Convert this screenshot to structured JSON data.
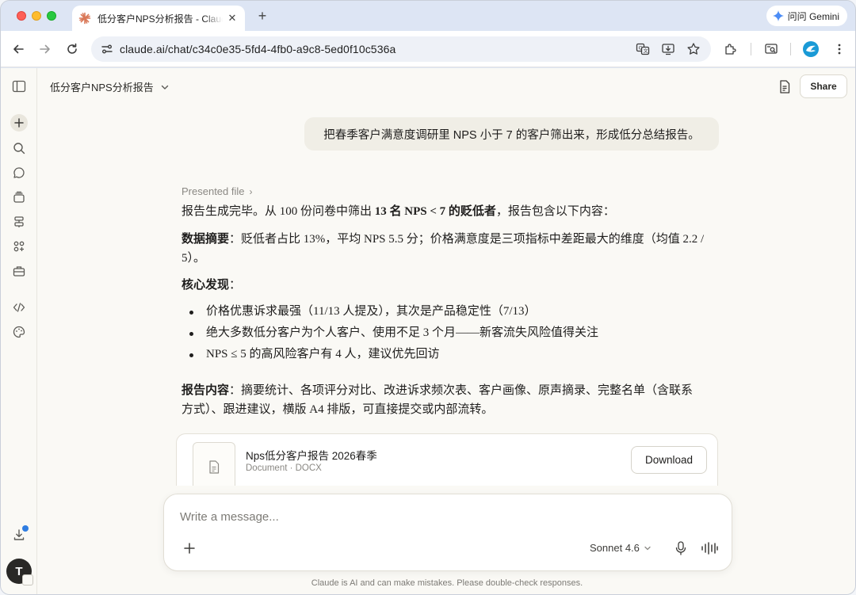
{
  "browser": {
    "tab_title": "低分客户NPS分析报告 - Claude",
    "url": "claude.ai/chat/c34c0e35-5fd4-4fb0-a9c8-5ed0f10c536a",
    "gemini_label": "问问 Gemini"
  },
  "header": {
    "chat_title": "低分客户NPS分析报告",
    "share_label": "Share"
  },
  "user_message": "把春季客户满意度调研里 NPS 小于 7 的客户筛出来，形成低分总结报告。",
  "reply": {
    "presented_label": "Presented file",
    "intro_prefix": "报告生成完毕。从 100 份问卷中筛出 ",
    "intro_bold": "13 名 NPS < 7 的贬低者",
    "intro_suffix": "，报告包含以下内容：",
    "summary_label": "数据摘要",
    "summary_text": "：贬低者占比 13%，平均 NPS 5.5 分；价格满意度是三项指标中差距最大的维度（均值 2.2 / 5）。",
    "findings_label": "核心发现",
    "findings_colon": "：",
    "findings": [
      "价格优惠诉求最强（11/13 人提及），其次是产品稳定性（7/13）",
      "绝大多数低分客户为个人客户、使用不足 3 个月——新客流失风险值得关注",
      "NPS ≤ 5 的高风险客户有 4 人，建议优先回访"
    ],
    "contents_label": "报告内容",
    "contents_text": "：摘要统计、各项评分对比、改进诉求频次表、客户画像、原声摘录、完整名单（含联系方式）、跟进建议，横版 A4 排版，可直接提交或内部流转。"
  },
  "file": {
    "name": "Nps低分客户报告 2026春季",
    "meta": "Document · DOCX",
    "download_label": "Download"
  },
  "composer": {
    "placeholder": "Write a message...",
    "model": "Sonnet 4.6"
  },
  "disclaimer": "Claude is AI and can make mistakes. Please double-check responses.",
  "avatar_initial": "T",
  "colors": {
    "accent": "#d97757",
    "app_bg": "#faf9f5",
    "user_bubble": "#f0eee6"
  }
}
